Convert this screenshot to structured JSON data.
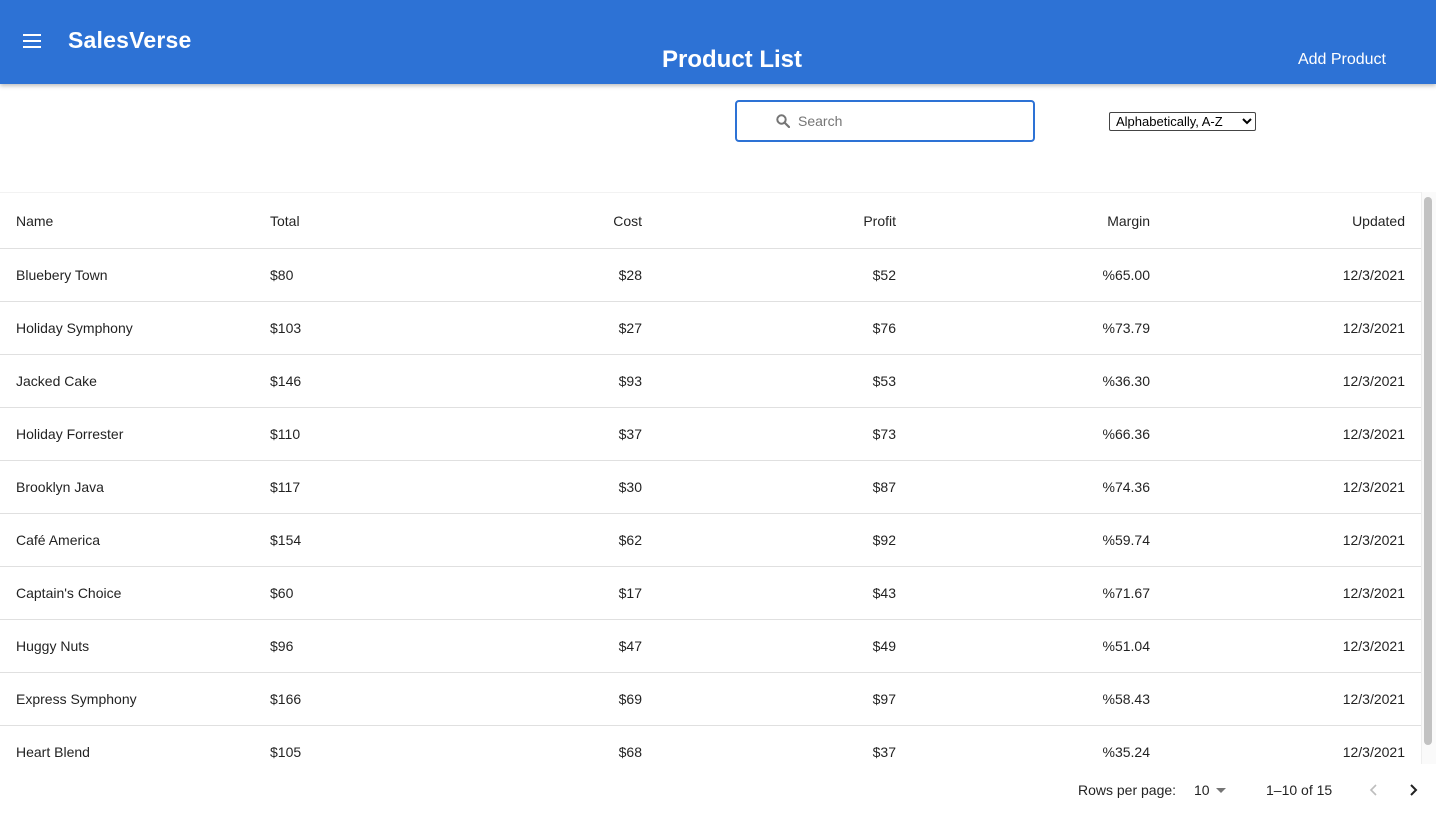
{
  "header": {
    "brand": "SalesVerse",
    "title": "Product List",
    "add_product_label": "Add Product",
    "accent_color": "#2d72d5"
  },
  "search": {
    "placeholder": "Search",
    "value": ""
  },
  "sort": {
    "selected": "Alphabetically, A-Z"
  },
  "table": {
    "columns": [
      "Name",
      "Total",
      "Cost",
      "Profit",
      "Margin",
      "Updated"
    ],
    "rows": [
      [
        "Bluebery Town",
        "$80",
        "$28",
        "$52",
        "%65.00",
        "12/3/2021"
      ],
      [
        "Holiday Symphony",
        "$103",
        "$27",
        "$76",
        "%73.79",
        "12/3/2021"
      ],
      [
        "Jacked Cake",
        "$146",
        "$93",
        "$53",
        "%36.30",
        "12/3/2021"
      ],
      [
        "Holiday Forrester",
        "$110",
        "$37",
        "$73",
        "%66.36",
        "12/3/2021"
      ],
      [
        "Brooklyn Java",
        "$117",
        "$30",
        "$87",
        "%74.36",
        "12/3/2021"
      ],
      [
        "Café America",
        "$154",
        "$62",
        "$92",
        "%59.74",
        "12/3/2021"
      ],
      [
        "Captain's Choice",
        "$60",
        "$17",
        "$43",
        "%71.67",
        "12/3/2021"
      ],
      [
        "Huggy Nuts",
        "$96",
        "$47",
        "$49",
        "%51.04",
        "12/3/2021"
      ],
      [
        "Express Symphony",
        "$166",
        "$69",
        "$97",
        "%58.43",
        "12/3/2021"
      ],
      [
        "Heart Blend",
        "$105",
        "$68",
        "$37",
        "%35.24",
        "12/3/2021"
      ]
    ]
  },
  "pagination": {
    "rows_per_page_label": "Rows per page:",
    "rows_per_page": "10",
    "range": "1–10 of 15"
  }
}
